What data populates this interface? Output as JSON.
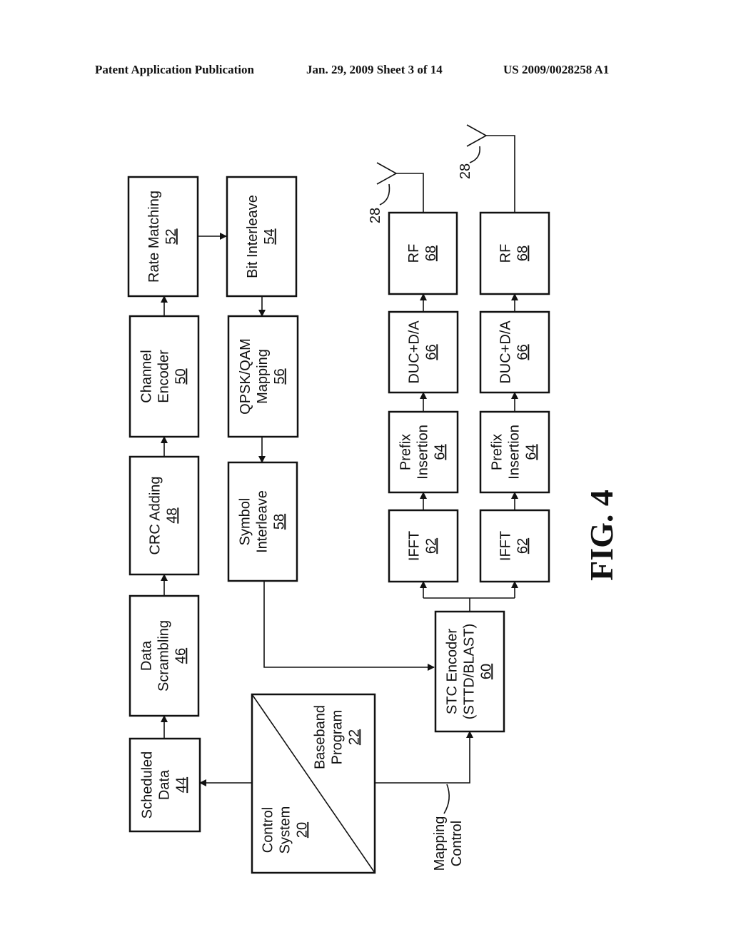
{
  "header": {
    "left": "Patent Application Publication",
    "center": "Jan. 29, 2009  Sheet 3 of 14",
    "right": "US 2009/0028258 A1"
  },
  "figure_label": "FIG. 4",
  "blocks": {
    "scheduled_data": {
      "lines": [
        "Scheduled",
        "Data"
      ],
      "ref": "44"
    },
    "data_scrambling": {
      "lines": [
        "Data",
        "Scrambling"
      ],
      "ref": "46"
    },
    "crc_adding": {
      "lines": [
        "CRC Adding"
      ],
      "ref": "48"
    },
    "channel_encoder": {
      "lines": [
        "Channel",
        "Encoder"
      ],
      "ref": "50"
    },
    "rate_matching": {
      "lines": [
        "Rate Matching"
      ],
      "ref": "52"
    },
    "bit_interleave": {
      "lines": [
        "Bit Interleave"
      ],
      "ref": "54"
    },
    "qpsk_qam_mapping": {
      "lines": [
        "QPSK/QAM",
        "Mapping"
      ],
      "ref": "56"
    },
    "symbol_interleave": {
      "lines": [
        "Symbol",
        "Interleave"
      ],
      "ref": "58"
    },
    "stc_encoder": {
      "lines": [
        "STC Encoder",
        "(STTD/BLAST)"
      ],
      "ref": "60"
    },
    "ifft_1": {
      "lines": [
        "IFFT"
      ],
      "ref": "62"
    },
    "ifft_2": {
      "lines": [
        "IFFT"
      ],
      "ref": "62"
    },
    "prefix_insertion_1": {
      "lines": [
        "Prefix",
        "Insertion"
      ],
      "ref": "64"
    },
    "prefix_insertion_2": {
      "lines": [
        "Prefix",
        "Insertion"
      ],
      "ref": "64"
    },
    "duc_da_1": {
      "lines": [
        "DUC+D/A"
      ],
      "ref": "66"
    },
    "duc_da_2": {
      "lines": [
        "DUC+D/A"
      ],
      "ref": "66"
    },
    "rf_1": {
      "lines": [
        "RF"
      ],
      "ref": "68"
    },
    "rf_2": {
      "lines": [
        "RF"
      ],
      "ref": "68"
    },
    "control_system": {
      "lines": [
        "Control",
        "System"
      ],
      "ref": "20"
    },
    "baseband_program": {
      "lines": [
        "Baseband",
        "Program"
      ],
      "ref": "22"
    }
  },
  "annotations": {
    "antenna_1": "28",
    "antenna_2": "28",
    "mapping_control": [
      "Mapping",
      "Control"
    ]
  }
}
